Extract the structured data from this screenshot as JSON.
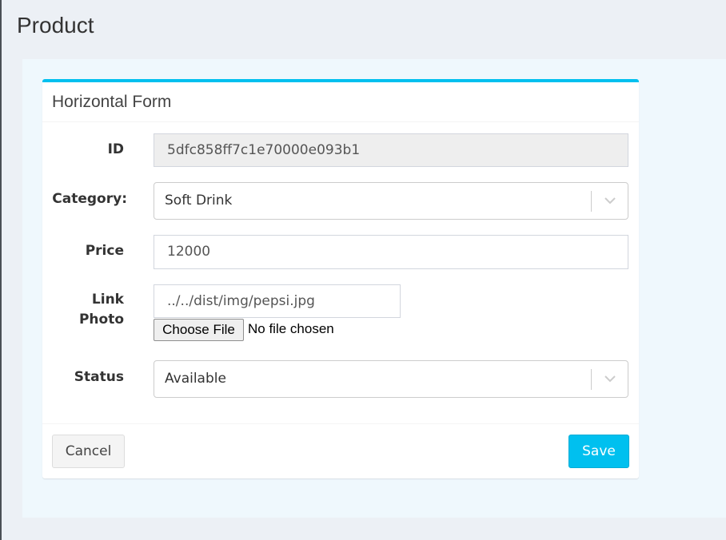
{
  "page": {
    "title": "Product"
  },
  "form": {
    "title": "Horizontal Form",
    "fields": {
      "id": {
        "label": "ID",
        "value": "5dfc858ff7c1e70000e093b1"
      },
      "category": {
        "label": "Category:",
        "value": "Soft Drink"
      },
      "price": {
        "label": "Price",
        "value": "12000"
      },
      "photo": {
        "label_line1": "Link",
        "label_line2": "Photo",
        "value": "../../dist/img/pepsi.jpg",
        "file_button": "Choose File",
        "file_status": "No file chosen"
      },
      "status": {
        "label": "Status",
        "value": "Available"
      }
    },
    "buttons": {
      "cancel": "Cancel",
      "save": "Save"
    }
  },
  "colors": {
    "accent": "#00c0ef",
    "background": "#ecf0f5"
  }
}
